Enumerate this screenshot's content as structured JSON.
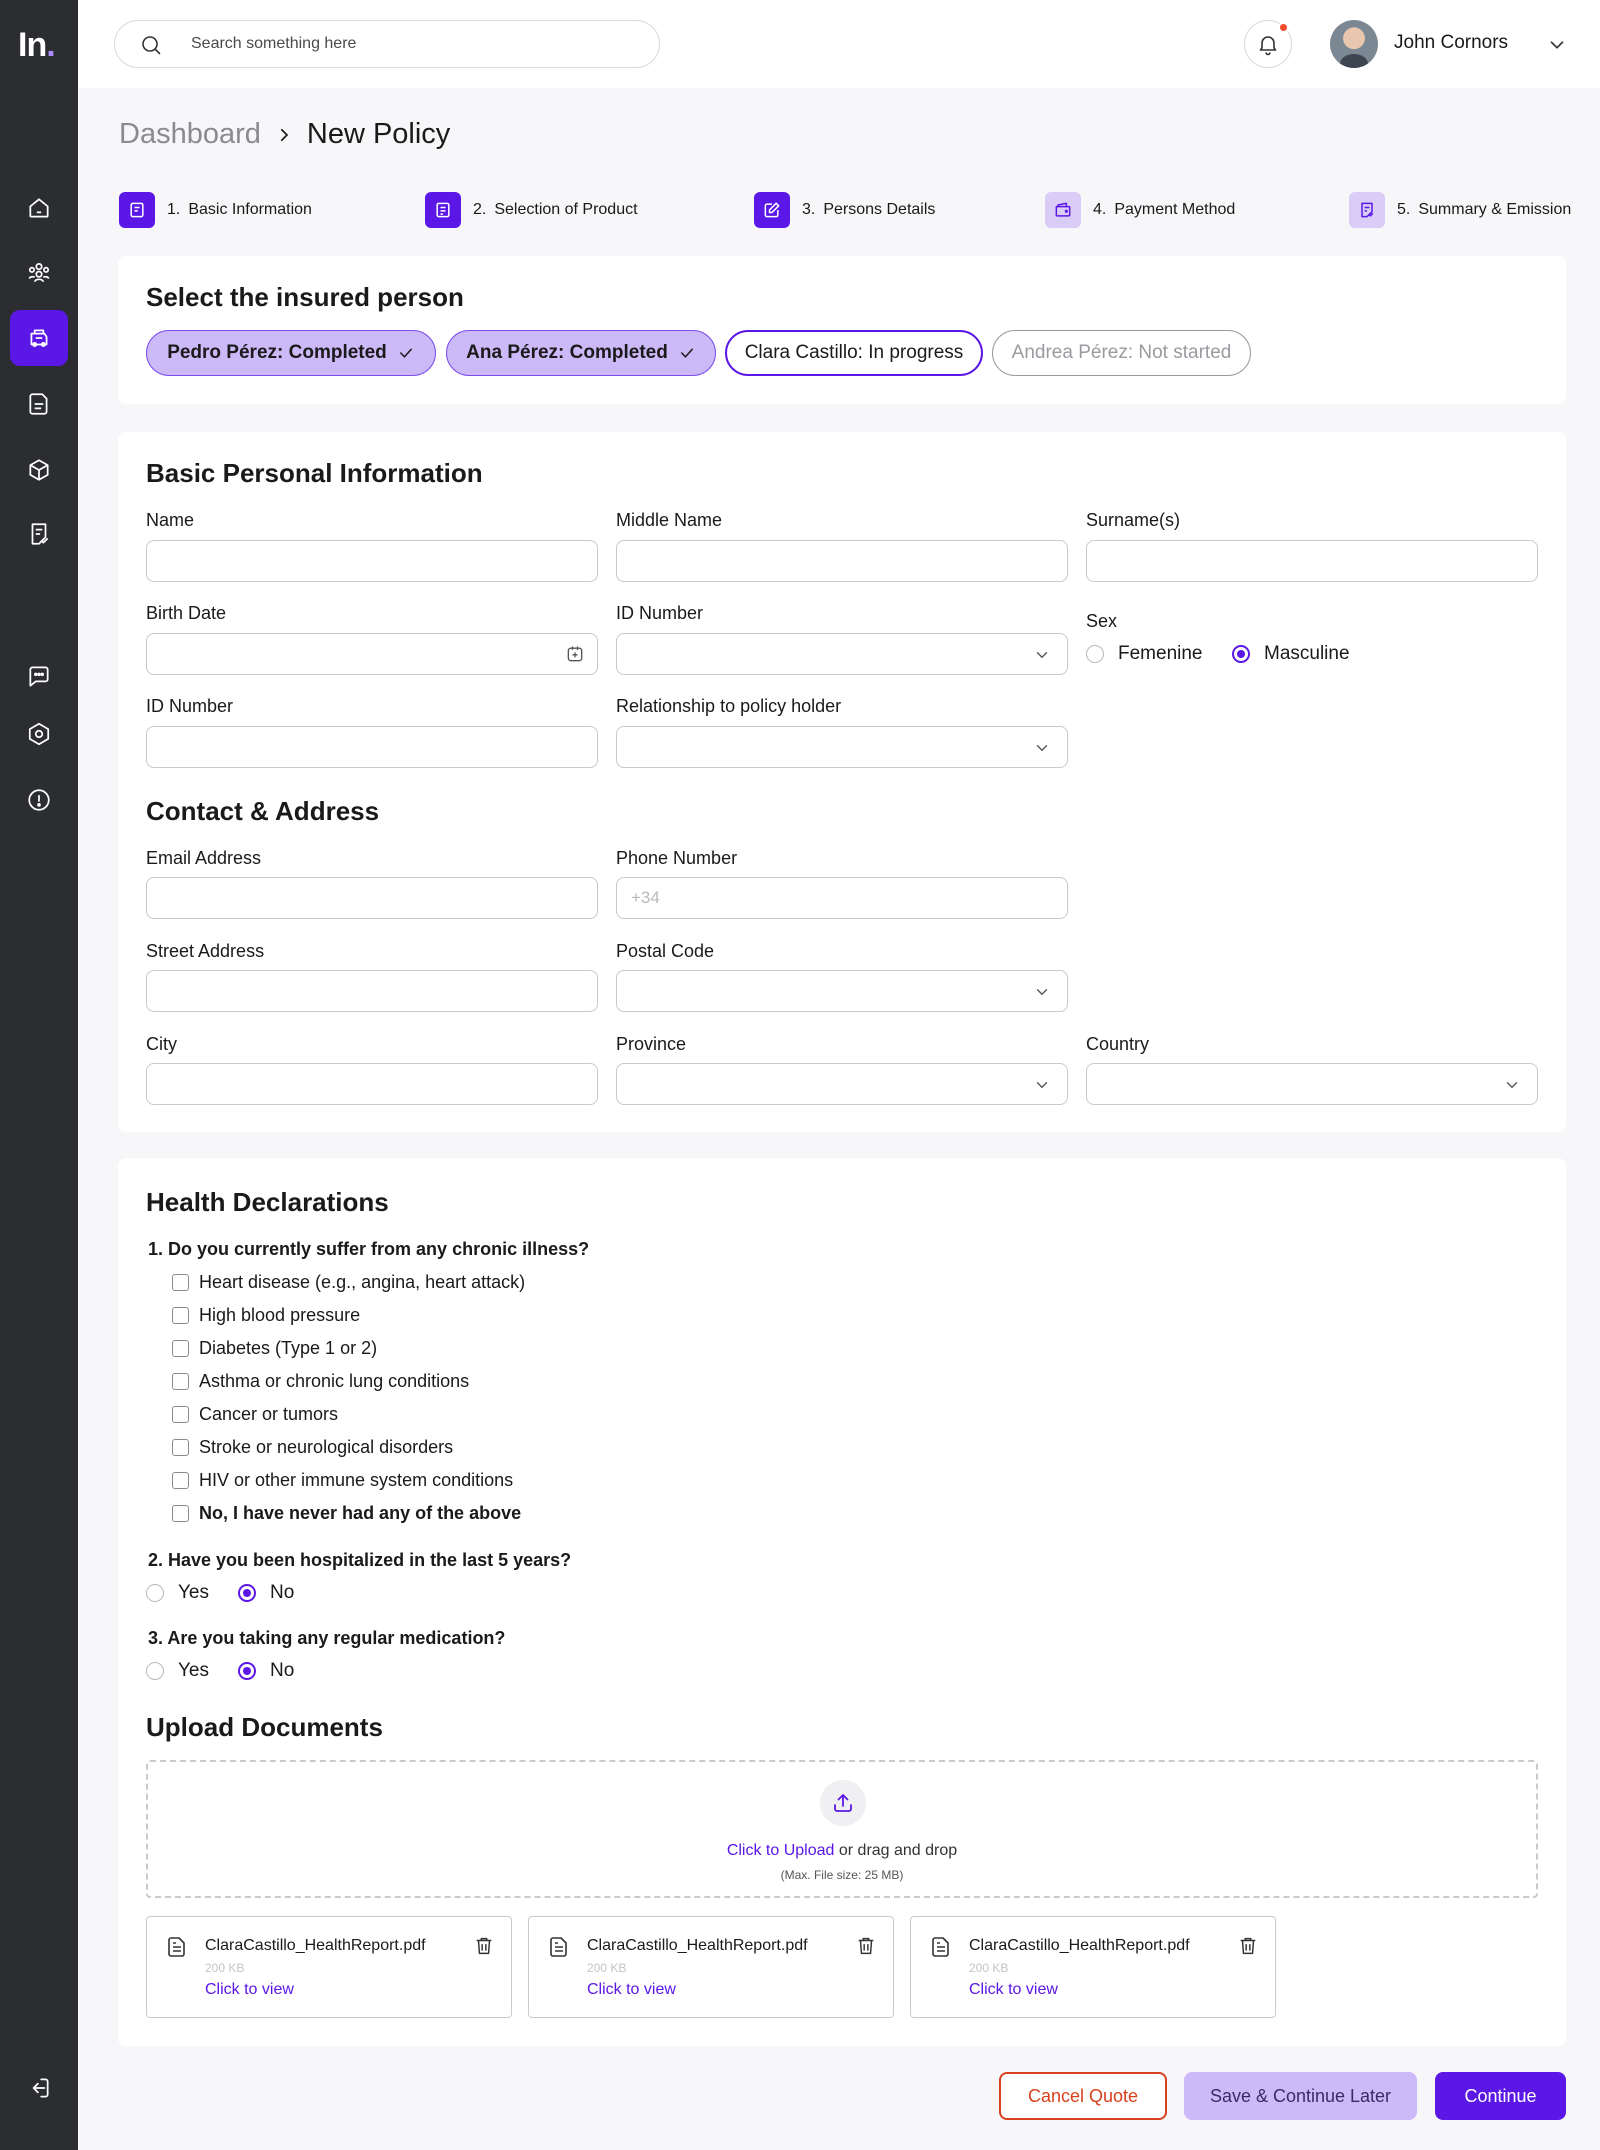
{
  "brand": {
    "logo_text": "In",
    "logo_dot": ".",
    "accent": "#5B17E6",
    "danger": "#D9411E",
    "soft": "#CBB9F8"
  },
  "sidebar": {
    "items": [
      {
        "icon": "home-icon"
      },
      {
        "icon": "users-icon"
      },
      {
        "icon": "policy-icon",
        "active": true
      },
      {
        "icon": "documents-icon"
      },
      {
        "icon": "product-box-icon"
      },
      {
        "icon": "reports-icon"
      },
      {
        "icon": "chat-icon"
      },
      {
        "icon": "settings-icon"
      },
      {
        "icon": "info-icon"
      },
      {
        "icon": "logout-icon"
      }
    ]
  },
  "header": {
    "search_placeholder": "Search something here",
    "user_name": "John Cornors"
  },
  "breadcrumb": {
    "parent": "Dashboard",
    "current": "New Policy"
  },
  "steps": [
    {
      "number": "1.",
      "label": "Basic Information",
      "done": true
    },
    {
      "number": "2.",
      "label": "Selection of Product",
      "done": true
    },
    {
      "number": "3.",
      "label": "Persons Details",
      "done": true
    },
    {
      "number": "4.",
      "label": "Payment Method",
      "done": false
    },
    {
      "number": "5.",
      "label": "Summary & Emission",
      "done": false
    }
  ],
  "persons": {
    "title": "Select the insured person",
    "items": [
      {
        "label": "Pedro Pérez: Completed",
        "status": "completed"
      },
      {
        "label": "Ana Pérez: Completed",
        "status": "completed"
      },
      {
        "label": "Clara Castillo: In progress",
        "status": "progress"
      },
      {
        "label": "Andrea Pérez: Not started",
        "status": "notstarted"
      }
    ]
  },
  "personal": {
    "title": "Basic Personal Information",
    "name_label": "Name",
    "middle_label": "Middle Name",
    "surname_label": "Surname(s)",
    "birth_label": "Birth Date",
    "idnum_label": "ID Number",
    "sex_label": "Sex",
    "sex_options": [
      "Femenine",
      "Masculine"
    ],
    "sex_selected": "Masculine",
    "idnum2_label": "ID Number",
    "relationship_label": "Relationship to policy holder"
  },
  "contact": {
    "title": "Contact & Address",
    "email_label": "Email Address",
    "phone_label": "Phone Number",
    "phone_placeholder": "+34",
    "street_label": "Street Address",
    "postal_label": "Postal Code",
    "city_label": "City",
    "province_label": "Province",
    "country_label": "Country"
  },
  "health": {
    "title": "Health Declarations",
    "q1": "1.  Do you currently suffer from any chronic illness?",
    "q1_options": [
      "Heart disease (e.g., angina, heart attack)",
      "High blood pressure",
      "Diabetes (Type 1 or 2)",
      "Asthma or chronic lung conditions",
      "Cancer or tumors",
      "Stroke or neurological disorders",
      "HIV or other immune system conditions",
      "No, I have never had any of the above"
    ],
    "q2": "2.  Have you been hospitalized in the last 5 years?",
    "q3": "3.  Are you taking any regular medication?",
    "yes": "Yes",
    "no": "No",
    "q2_selected": "No",
    "q3_selected": "No"
  },
  "upload": {
    "title": "Upload Documents",
    "link": "Click to Upload",
    "rest": " or drag and drop",
    "hint": "(Max. File size: 25 MB)",
    "files": [
      {
        "name": "ClaraCastillo_HealthReport.pdf",
        "size": "200 KB",
        "view": "Click to view"
      },
      {
        "name": "ClaraCastillo_HealthReport.pdf",
        "size": "200 KB",
        "view": "Click to view"
      },
      {
        "name": "ClaraCastillo_HealthReport.pdf",
        "size": "200 KB",
        "view": "Click to view"
      }
    ]
  },
  "actions": {
    "cancel": "Cancel Quote",
    "save": "Save & Continue Later",
    "continue": "Continue"
  }
}
